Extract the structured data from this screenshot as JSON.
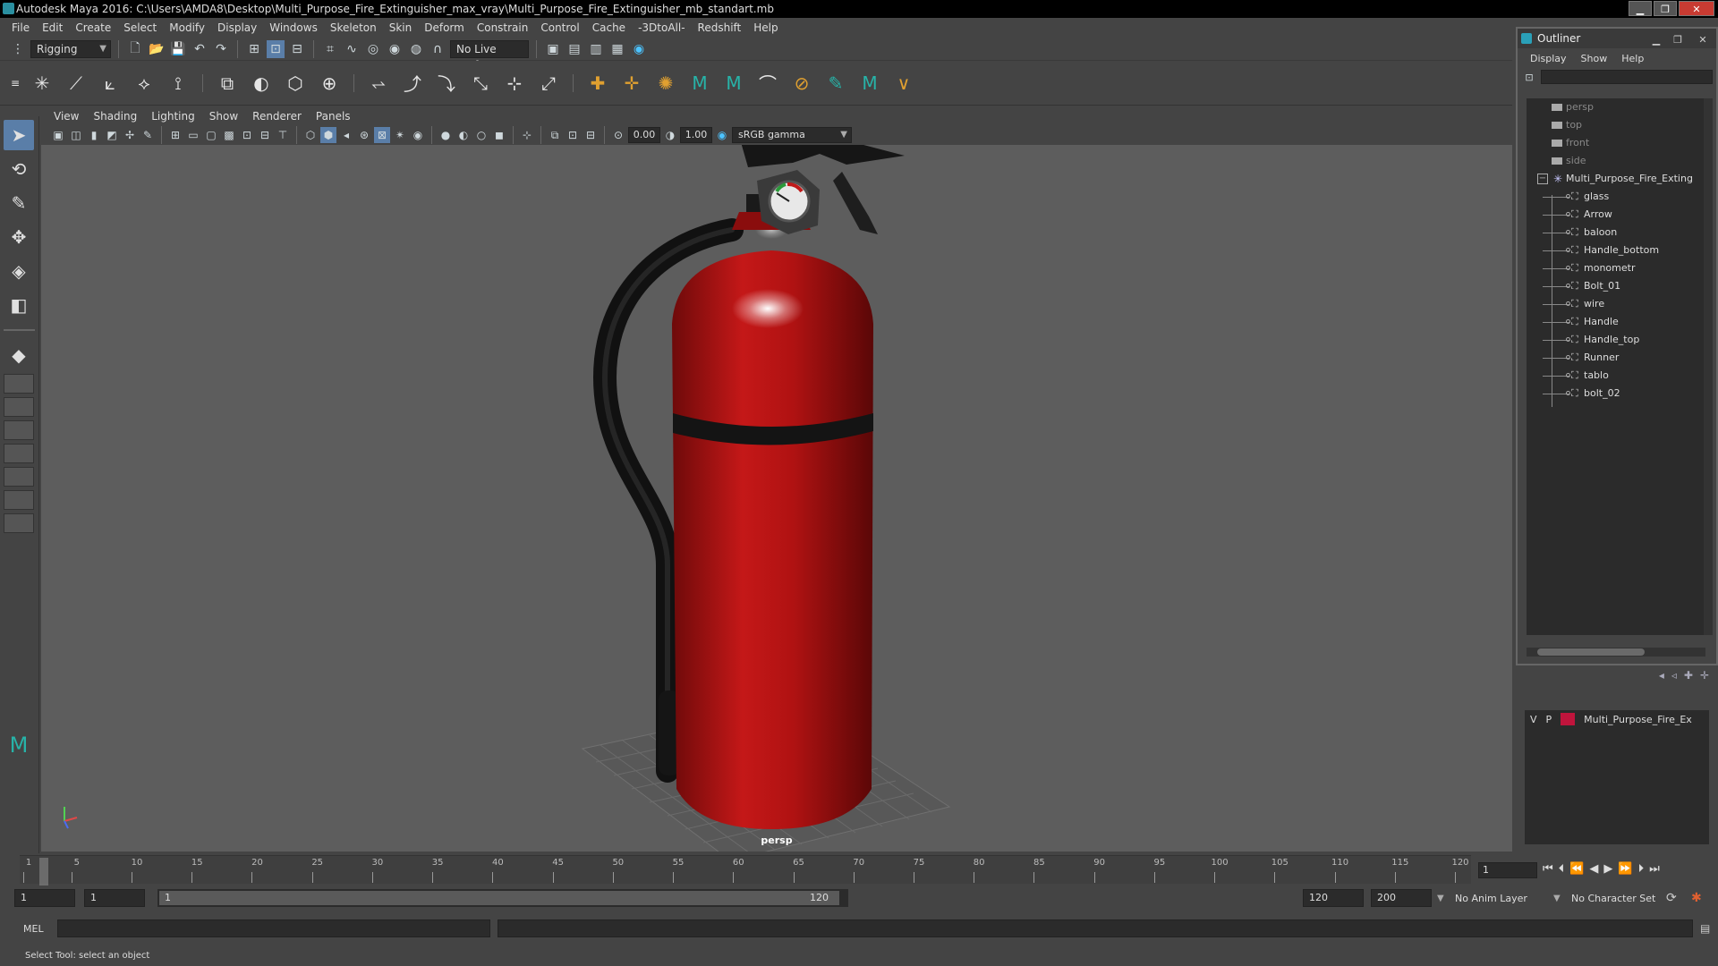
{
  "window": {
    "title": "Autodesk Maya 2016: C:\\Users\\AMDA8\\Desktop\\Multi_Purpose_Fire_Extinguisher_max_vray\\Multi_Purpose_Fire_Extinguisher_mb_standart.mb"
  },
  "menubar": {
    "items": [
      "File",
      "Edit",
      "Create",
      "Select",
      "Modify",
      "Display",
      "Windows",
      "Skeleton",
      "Skin",
      "Deform",
      "Constrain",
      "Control",
      "Cache",
      "-3DtoAll-",
      "Redshift",
      "Help"
    ]
  },
  "statusline": {
    "mode": "Rigging",
    "live_surface": "No Live Surface"
  },
  "panel": {
    "menu": [
      "View",
      "Shading",
      "Lighting",
      "Show",
      "Renderer",
      "Panels"
    ],
    "exposure": "0.00",
    "gamma": "1.00",
    "colorspace": "sRGB gamma",
    "camera": "persp"
  },
  "outliner": {
    "title": "Outliner",
    "menu": [
      "Display",
      "Show",
      "Help"
    ],
    "cameras": [
      "persp",
      "top",
      "front",
      "side"
    ],
    "root": "Multi_Purpose_Fire_Exting",
    "children": [
      "glass",
      "Arrow",
      "baloon",
      "Handle_bottom",
      "monometr",
      "Bolt_01",
      "wire",
      "Handle",
      "Handle_top",
      "Runner",
      "tablo",
      "bolt_02"
    ]
  },
  "layers": {
    "v": "V",
    "p": "P",
    "name": "Multi_Purpose_Fire_Ex",
    "color": "#c0143c"
  },
  "timeline": {
    "ticks": [
      "1",
      "5",
      "10",
      "15",
      "20",
      "25",
      "30",
      "35",
      "40",
      "45",
      "50",
      "55",
      "60",
      "65",
      "70",
      "75",
      "80",
      "85",
      "90",
      "95",
      "100",
      "105",
      "110",
      "115",
      "120"
    ],
    "current_frame": "1"
  },
  "range": {
    "start": "1",
    "playback_start": "1",
    "slider_start": "1",
    "slider_end": "120",
    "playback_end": "120",
    "end": "200",
    "anim_layer": "No Anim Layer",
    "char_set": "No Character Set"
  },
  "cmdline": {
    "label": "MEL"
  },
  "helpline": {
    "text": "Select Tool: select an object"
  }
}
